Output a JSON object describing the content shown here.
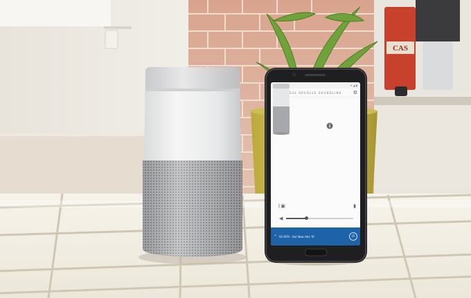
{
  "phone": {
    "status_time": "",
    "app_header_title": "BOSE REVOLVE SOUNDLINK",
    "icons": {
      "back": "back-arrow-icon",
      "settings": "gear-icon",
      "bluetooth": "bluetooth-icon",
      "source": "source-icon",
      "volume": "volume-icon",
      "info": "info-icon",
      "chevron": "chevron-up-icon",
      "action": "power-icon"
    },
    "now_playing": "92.9FM - Hot New Hits 'N'",
    "volume_level": 0.3,
    "accent_color": "#1e63a8"
  },
  "background": {
    "sign_text": "CAS"
  }
}
